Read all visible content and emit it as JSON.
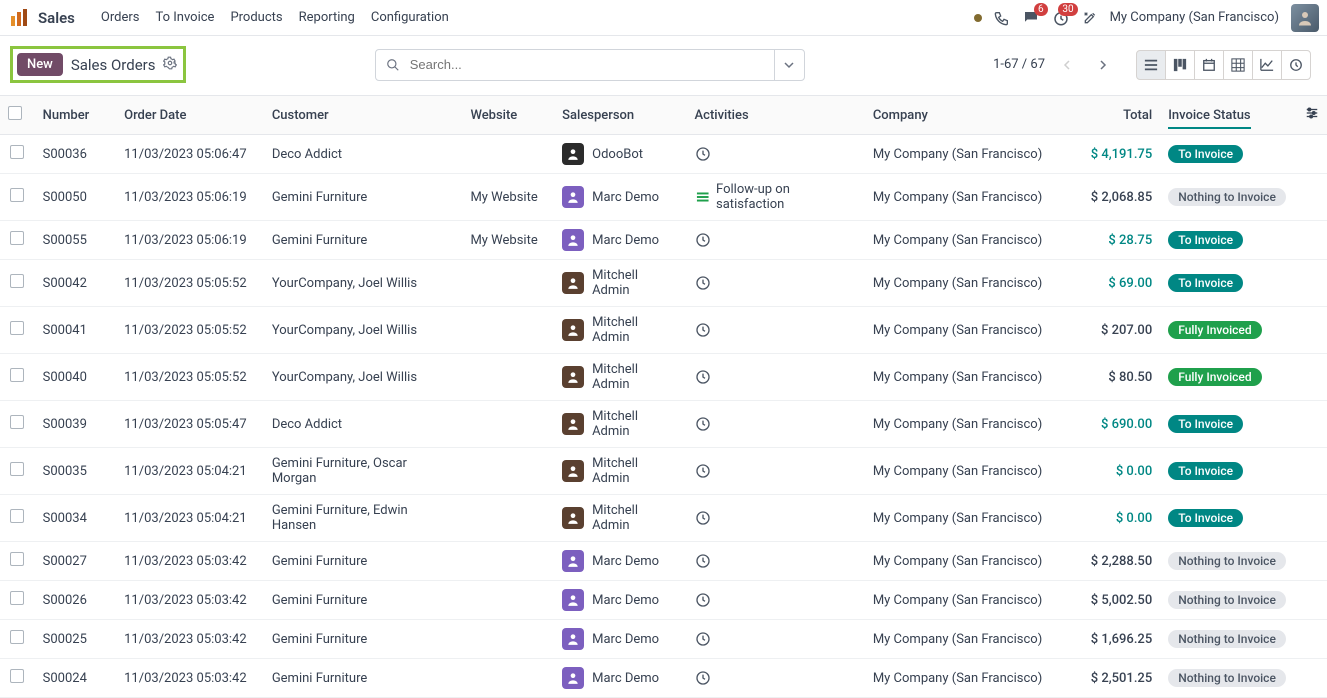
{
  "nav": {
    "app": "Sales",
    "menus": [
      "Orders",
      "To Invoice",
      "Products",
      "Reporting",
      "Configuration"
    ],
    "msg_badge": "6",
    "timer_badge": "30",
    "company": "My Company (San Francisco)"
  },
  "cp": {
    "new_btn": "New",
    "breadcrumb": "Sales Orders",
    "search_placeholder": "Search...",
    "pager": "1-67 / 67"
  },
  "columns": {
    "number": "Number",
    "order_date": "Order Date",
    "customer": "Customer",
    "website": "Website",
    "salesperson": "Salesperson",
    "activities": "Activities",
    "company": "Company",
    "total": "Total",
    "invoice_status": "Invoice Status"
  },
  "status_labels": {
    "to_invoice": "To Invoice",
    "nothing": "Nothing to Invoice",
    "fully": "Fully Invoiced"
  },
  "rows": [
    {
      "num": "S00036",
      "date": "11/03/2023 05:06:47",
      "cust": "Deco Addict",
      "web": "",
      "sp": "OdooBot",
      "sp_ava": "bot",
      "act": "clock",
      "company": "My Company (San Francisco)",
      "total": "$ 4,191.75",
      "total_style": "invoice",
      "status": "to_invoice"
    },
    {
      "num": "S00050",
      "date": "11/03/2023 05:06:19",
      "cust": "Gemini Furniture",
      "web": "My Website",
      "sp": "Marc Demo",
      "sp_ava": "marc",
      "act": "followup",
      "act_text": "Follow-up on satisfaction",
      "company": "My Company (San Francisco)",
      "total": "$ 2,068.85",
      "total_style": "plain",
      "status": "nothing"
    },
    {
      "num": "S00055",
      "date": "11/03/2023 05:06:19",
      "cust": "Gemini Furniture",
      "web": "My Website",
      "sp": "Marc Demo",
      "sp_ava": "marc",
      "act": "clock",
      "company": "My Company (San Francisco)",
      "total": "$ 28.75",
      "total_style": "invoice",
      "status": "to_invoice"
    },
    {
      "num": "S00042",
      "date": "11/03/2023 05:05:52",
      "cust": "YourCompany, Joel Willis",
      "web": "",
      "sp": "Mitchell Admin",
      "sp_ava": "mitch",
      "act": "clock",
      "company": "My Company (San Francisco)",
      "total": "$ 69.00",
      "total_style": "invoice",
      "status": "to_invoice"
    },
    {
      "num": "S00041",
      "date": "11/03/2023 05:05:52",
      "cust": "YourCompany, Joel Willis",
      "web": "",
      "sp": "Mitchell Admin",
      "sp_ava": "mitch",
      "act": "clock",
      "company": "My Company (San Francisco)",
      "total": "$ 207.00",
      "total_style": "plain",
      "status": "fully"
    },
    {
      "num": "S00040",
      "date": "11/03/2023 05:05:52",
      "cust": "YourCompany, Joel Willis",
      "web": "",
      "sp": "Mitchell Admin",
      "sp_ava": "mitch",
      "act": "clock",
      "company": "My Company (San Francisco)",
      "total": "$ 80.50",
      "total_style": "plain",
      "status": "fully"
    },
    {
      "num": "S00039",
      "date": "11/03/2023 05:05:47",
      "cust": "Deco Addict",
      "web": "",
      "sp": "Mitchell Admin",
      "sp_ava": "mitch",
      "act": "clock",
      "company": "My Company (San Francisco)",
      "total": "$ 690.00",
      "total_style": "invoice",
      "status": "to_invoice"
    },
    {
      "num": "S00035",
      "date": "11/03/2023 05:04:21",
      "cust": "Gemini Furniture, Oscar Morgan",
      "web": "",
      "sp": "Mitchell Admin",
      "sp_ava": "mitch",
      "act": "clock",
      "company": "My Company (San Francisco)",
      "total": "$ 0.00",
      "total_style": "invoice",
      "status": "to_invoice"
    },
    {
      "num": "S00034",
      "date": "11/03/2023 05:04:21",
      "cust": "Gemini Furniture, Edwin Hansen",
      "web": "",
      "sp": "Mitchell Admin",
      "sp_ava": "mitch",
      "act": "clock",
      "company": "My Company (San Francisco)",
      "total": "$ 0.00",
      "total_style": "invoice",
      "status": "to_invoice"
    },
    {
      "num": "S00027",
      "date": "11/03/2023 05:03:42",
      "cust": "Gemini Furniture",
      "web": "",
      "sp": "Marc Demo",
      "sp_ava": "marc",
      "act": "clock",
      "company": "My Company (San Francisco)",
      "total": "$ 2,288.50",
      "total_style": "plain",
      "status": "nothing"
    },
    {
      "num": "S00026",
      "date": "11/03/2023 05:03:42",
      "cust": "Gemini Furniture",
      "web": "",
      "sp": "Marc Demo",
      "sp_ava": "marc",
      "act": "clock",
      "company": "My Company (San Francisco)",
      "total": "$ 5,002.50",
      "total_style": "plain",
      "status": "nothing"
    },
    {
      "num": "S00025",
      "date": "11/03/2023 05:03:42",
      "cust": "Gemini Furniture",
      "web": "",
      "sp": "Marc Demo",
      "sp_ava": "marc",
      "act": "clock",
      "company": "My Company (San Francisco)",
      "total": "$ 1,696.25",
      "total_style": "plain",
      "status": "nothing"
    },
    {
      "num": "S00024",
      "date": "11/03/2023 05:03:42",
      "cust": "Gemini Furniture",
      "web": "",
      "sp": "Marc Demo",
      "sp_ava": "marc",
      "act": "clock",
      "company": "My Company (San Francisco)",
      "total": "$ 2,501.25",
      "total_style": "plain",
      "status": "nothing"
    }
  ]
}
